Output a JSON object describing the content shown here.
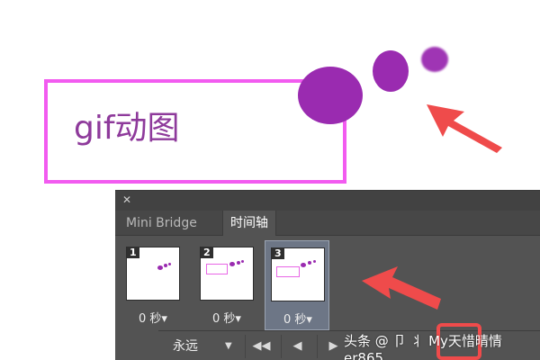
{
  "preview": {
    "text": "gif动图",
    "box_color": "#f25bf0",
    "dot_color": "#9a2bb0",
    "arrow_color": "#ef4b4b"
  },
  "panel": {
    "close_icon": "close-icon",
    "tabs": [
      {
        "label": "Mini Bridge",
        "active": false
      },
      {
        "label": "时间轴",
        "active": true
      }
    ],
    "frames": [
      {
        "number": "1",
        "delay": "0 秒▾",
        "selected": false
      },
      {
        "number": "2",
        "delay": "0 秒▾",
        "selected": false
      },
      {
        "number": "3",
        "delay": "0 秒▾",
        "selected": true
      }
    ],
    "controls": {
      "loop_label": "永远",
      "buttons": [
        "first-frame-icon",
        "previous-frame-icon",
        "play-icon"
      ]
    }
  },
  "watermark": "头条 @ 卩 丬 My天惜晴情er865"
}
